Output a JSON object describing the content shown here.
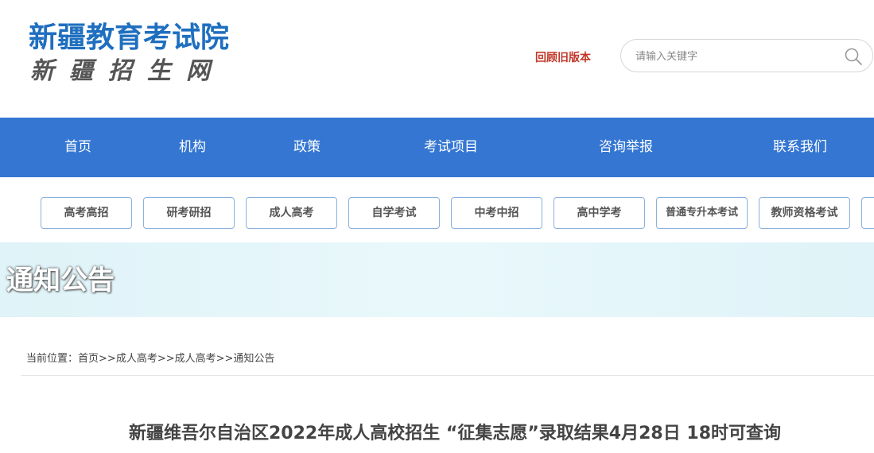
{
  "header": {
    "logo_main": "新疆教育考试院",
    "logo_sub": "新疆招生网",
    "old_version_link": "回顾旧版本",
    "search_placeholder": "请输入关键字"
  },
  "main_nav": [
    "首页",
    "机构",
    "政策",
    "考试项目",
    "咨询举报",
    "联系我们"
  ],
  "categories": [
    "高考高招",
    "研考研招",
    "成人高考",
    "自学考试",
    "中考中招",
    "高中学考",
    "普通专升本考试",
    "教师资格考试"
  ],
  "banner": {
    "title": "通知公告"
  },
  "breadcrumb": {
    "prefix": "当前位置：",
    "items": [
      "首页",
      "成人高考",
      "成人高考",
      "通知公告"
    ],
    "separator": ">>"
  },
  "article": {
    "title": "新疆维吾尔自治区2022年成人高校招生 “征集志愿”录取结果4月28日 18时可查询"
  },
  "colors": {
    "nav_bg": "#3476d2",
    "logo_blue": "#1f6fbf",
    "old_version_red": "#c0392b",
    "category_border": "#8ab0df",
    "banner_bg": "#e6f6fa"
  }
}
